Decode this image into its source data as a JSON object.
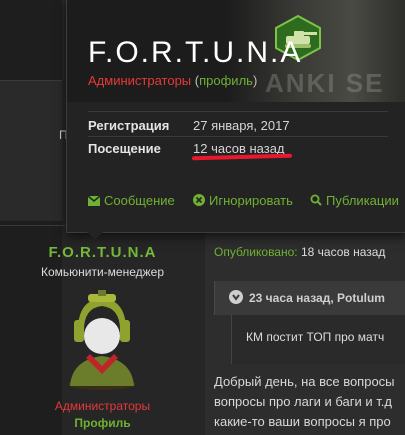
{
  "card": {
    "username": "F.O.R.T.U.N.A",
    "group": "Администраторы",
    "paren_open": "(",
    "profile_link": "профиль",
    "paren_close": ")",
    "banner_text": "ANKI SE",
    "info": [
      {
        "label": "Регистрация",
        "value": "27 января, 2017"
      },
      {
        "label": "Посещение",
        "value": "12 часов назад"
      }
    ],
    "actions": [
      {
        "label": "Сообщение",
        "icon": "envelope-icon"
      },
      {
        "label": "Игнорировать",
        "icon": "block-icon"
      },
      {
        "label": "Публикации",
        "icon": "search-icon"
      }
    ]
  },
  "left_letter": "П",
  "profile": {
    "username": "F.O.R.T.U.N.A",
    "role": "Комьюнити-менеджер",
    "group": "Администраторы",
    "profile_link": "Профиль"
  },
  "post": {
    "published_label": "Опубликовано:",
    "published_value": "18 часов назад",
    "quote_header": "23 часа назад, Potulum",
    "quote_body": "КМ постит ТОП про матч",
    "lines": [
      "Добрый день, на все вопросы",
      "вопросы про лаги и баги и т.д",
      "какие-то ваши вопросы я про"
    ]
  },
  "colors": {
    "accent_green": "#6fb133",
    "admin_red": "#e53a3a",
    "underline_red": "#e8192c"
  }
}
